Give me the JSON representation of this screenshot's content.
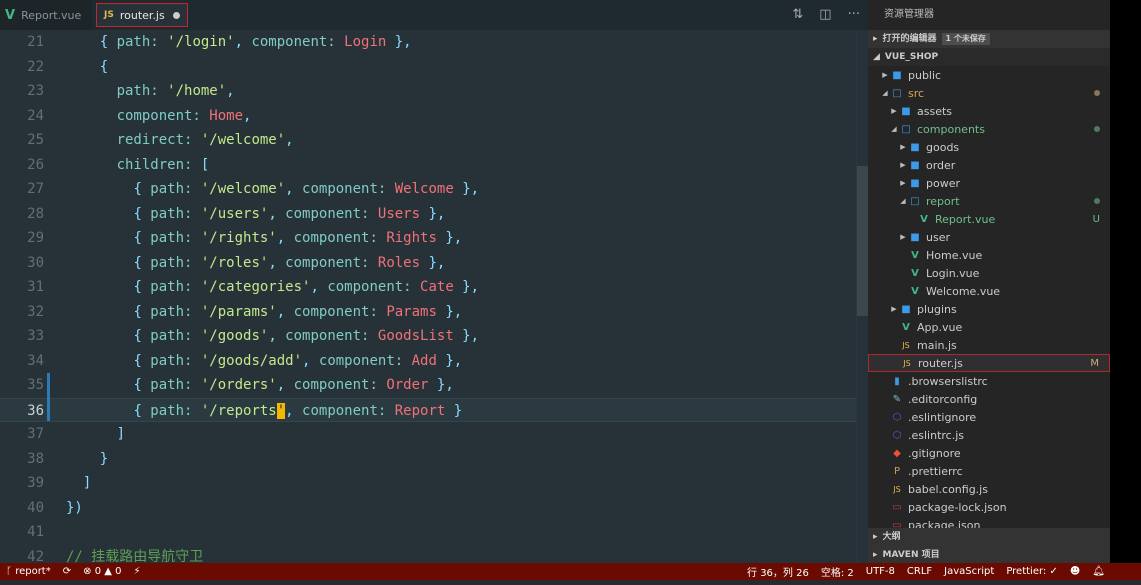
{
  "tabs": [
    {
      "label": "Report.vue",
      "icon": "vue-icon"
    },
    {
      "label": "router.js",
      "icon": "js-icon",
      "modified": true
    }
  ],
  "editor": {
    "current_line": 36,
    "cursor_char": "'",
    "lines": [
      {
        "n": 21,
        "t": [
          [
            "    ",
            ""
          ],
          [
            "{ ",
            "p"
          ],
          [
            "path: ",
            "k"
          ],
          [
            "'/login'",
            "s"
          ],
          [
            ", ",
            "p"
          ],
          [
            "component: ",
            "k"
          ],
          [
            "Login",
            "c"
          ],
          [
            " },",
            "p"
          ]
        ]
      },
      {
        "n": 22,
        "t": [
          [
            "    ",
            ""
          ],
          [
            "{",
            "p"
          ]
        ]
      },
      {
        "n": 23,
        "t": [
          [
            "      ",
            ""
          ],
          [
            "path: ",
            "k"
          ],
          [
            "'/home'",
            "s"
          ],
          [
            ",",
            "p"
          ]
        ]
      },
      {
        "n": 24,
        "t": [
          [
            "      ",
            ""
          ],
          [
            "component: ",
            "k"
          ],
          [
            "Home",
            "c"
          ],
          [
            ",",
            "p"
          ]
        ]
      },
      {
        "n": 25,
        "t": [
          [
            "      ",
            ""
          ],
          [
            "redirect: ",
            "k"
          ],
          [
            "'/welcome'",
            "s"
          ],
          [
            ",",
            "p"
          ]
        ]
      },
      {
        "n": 26,
        "t": [
          [
            "      ",
            ""
          ],
          [
            "children: ",
            "k"
          ],
          [
            "[",
            "p"
          ]
        ]
      },
      {
        "n": 27,
        "t": [
          [
            "        ",
            ""
          ],
          [
            "{ ",
            "p"
          ],
          [
            "path: ",
            "k"
          ],
          [
            "'/welcome'",
            "s"
          ],
          [
            ", ",
            "p"
          ],
          [
            "component: ",
            "k"
          ],
          [
            "Welcome",
            "c"
          ],
          [
            " },",
            "p"
          ]
        ]
      },
      {
        "n": 28,
        "t": [
          [
            "        ",
            ""
          ],
          [
            "{ ",
            "p"
          ],
          [
            "path: ",
            "k"
          ],
          [
            "'/users'",
            "s"
          ],
          [
            ", ",
            "p"
          ],
          [
            "component: ",
            "k"
          ],
          [
            "Users",
            "c"
          ],
          [
            " },",
            "p"
          ]
        ]
      },
      {
        "n": 29,
        "t": [
          [
            "        ",
            ""
          ],
          [
            "{ ",
            "p"
          ],
          [
            "path: ",
            "k"
          ],
          [
            "'/rights'",
            "s"
          ],
          [
            ", ",
            "p"
          ],
          [
            "component: ",
            "k"
          ],
          [
            "Rights",
            "c"
          ],
          [
            " },",
            "p"
          ]
        ]
      },
      {
        "n": 30,
        "t": [
          [
            "        ",
            ""
          ],
          [
            "{ ",
            "p"
          ],
          [
            "path: ",
            "k"
          ],
          [
            "'/roles'",
            "s"
          ],
          [
            ", ",
            "p"
          ],
          [
            "component: ",
            "k"
          ],
          [
            "Roles",
            "c"
          ],
          [
            " },",
            "p"
          ]
        ]
      },
      {
        "n": 31,
        "t": [
          [
            "        ",
            ""
          ],
          [
            "{ ",
            "p"
          ],
          [
            "path: ",
            "k"
          ],
          [
            "'/categories'",
            "s"
          ],
          [
            ", ",
            "p"
          ],
          [
            "component: ",
            "k"
          ],
          [
            "Cate",
            "c"
          ],
          [
            " },",
            "p"
          ]
        ]
      },
      {
        "n": 32,
        "t": [
          [
            "        ",
            ""
          ],
          [
            "{ ",
            "p"
          ],
          [
            "path: ",
            "k"
          ],
          [
            "'/params'",
            "s"
          ],
          [
            ", ",
            "p"
          ],
          [
            "component: ",
            "k"
          ],
          [
            "Params",
            "c"
          ],
          [
            " },",
            "p"
          ]
        ]
      },
      {
        "n": 33,
        "t": [
          [
            "        ",
            ""
          ],
          [
            "{ ",
            "p"
          ],
          [
            "path: ",
            "k"
          ],
          [
            "'/goods'",
            "s"
          ],
          [
            ", ",
            "p"
          ],
          [
            "component: ",
            "k"
          ],
          [
            "GoodsList",
            "c"
          ],
          [
            " },",
            "p"
          ]
        ]
      },
      {
        "n": 34,
        "t": [
          [
            "        ",
            ""
          ],
          [
            "{ ",
            "p"
          ],
          [
            "path: ",
            "k"
          ],
          [
            "'/goods/add'",
            "s"
          ],
          [
            ", ",
            "p"
          ],
          [
            "component: ",
            "k"
          ],
          [
            "Add",
            "c"
          ],
          [
            " },",
            "p"
          ]
        ]
      },
      {
        "n": 35,
        "t": [
          [
            "        ",
            ""
          ],
          [
            "{ ",
            "p"
          ],
          [
            "path: ",
            "k"
          ],
          [
            "'/orders'",
            "s"
          ],
          [
            ", ",
            "p"
          ],
          [
            "component: ",
            "k"
          ],
          [
            "Order",
            "c"
          ],
          [
            " },",
            "p"
          ]
        ]
      },
      {
        "n": 36,
        "t": [
          [
            "        ",
            ""
          ],
          [
            "{ ",
            "p"
          ],
          [
            "path: ",
            "k"
          ],
          [
            "'/reports",
            "s"
          ],
          [
            "'",
            "cursor"
          ],
          [
            ", ",
            "p"
          ],
          [
            "component: ",
            "k"
          ],
          [
            "Report",
            "c"
          ],
          [
            " }",
            "p"
          ]
        ]
      },
      {
        "n": 37,
        "t": [
          [
            "      ",
            ""
          ],
          [
            "]",
            "p"
          ]
        ]
      },
      {
        "n": 38,
        "t": [
          [
            "    ",
            ""
          ],
          [
            "}",
            "p"
          ]
        ]
      },
      {
        "n": 39,
        "t": [
          [
            "  ",
            ""
          ],
          [
            "]",
            "p"
          ]
        ]
      },
      {
        "n": 40,
        "t": [
          [
            "})",
            "p"
          ]
        ]
      },
      {
        "n": 41,
        "t": []
      },
      {
        "n": 42,
        "t": [
          [
            "// 挂载路由导航守卫",
            "cm"
          ]
        ]
      }
    ]
  },
  "explorer": {
    "title": "资源管理器",
    "open_editors": "打开的编辑器",
    "unsaved_badge": "1 个未保存",
    "project": "VUE_SHOP",
    "tree": [
      {
        "label": "public",
        "depth": 0,
        "type": "folder",
        "open": false
      },
      {
        "label": "src",
        "depth": 0,
        "type": "folder",
        "open": true,
        "color": "#d7a35a",
        "dot": "#8c7458"
      },
      {
        "label": "assets",
        "depth": 1,
        "type": "folder",
        "open": false
      },
      {
        "label": "components",
        "depth": 1,
        "type": "folder",
        "open": true,
        "color": "#6fbf8a",
        "dot": "#4f7a5e"
      },
      {
        "label": "goods",
        "depth": 2,
        "type": "folder",
        "open": false
      },
      {
        "label": "order",
        "depth": 2,
        "type": "folder",
        "open": false
      },
      {
        "label": "power",
        "depth": 2,
        "type": "folder",
        "open": false
      },
      {
        "label": "report",
        "depth": 2,
        "type": "folder",
        "open": true,
        "color": "#6fbf8a",
        "dot": "#4f7a5e"
      },
      {
        "label": "Report.vue",
        "depth": 3,
        "type": "vue",
        "color": "#6fbf8a",
        "status": "U"
      },
      {
        "label": "user",
        "depth": 2,
        "type": "folder",
        "open": false
      },
      {
        "label": "Home.vue",
        "depth": 2,
        "type": "vue",
        "file": true
      },
      {
        "label": "Login.vue",
        "depth": 2,
        "type": "vue",
        "file": true
      },
      {
        "label": "Welcome.vue",
        "depth": 2,
        "type": "vue",
        "file": true
      },
      {
        "label": "plugins",
        "depth": 1,
        "type": "folder",
        "open": false
      },
      {
        "label": "App.vue",
        "depth": 1,
        "type": "vue",
        "file": true
      },
      {
        "label": "main.js",
        "depth": 1,
        "type": "js",
        "file": true
      },
      {
        "label": "router.js",
        "depth": 1,
        "type": "js",
        "file": true,
        "selected": true,
        "status": "M"
      },
      {
        "label": ".browserslistrc",
        "depth": 0,
        "type": "doc",
        "file": true
      },
      {
        "label": ".editorconfig",
        "depth": 0,
        "type": "editorconfig",
        "file": true
      },
      {
        "label": ".eslintignore",
        "depth": 0,
        "type": "eslint",
        "file": true
      },
      {
        "label": ".eslintrc.js",
        "depth": 0,
        "type": "eslint",
        "file": true
      },
      {
        "label": ".gitignore",
        "depth": 0,
        "type": "git",
        "file": true
      },
      {
        "label": ".prettierrc",
        "depth": 0,
        "type": "prettier",
        "file": true
      },
      {
        "label": "babel.config.js",
        "depth": 0,
        "type": "js",
        "file": true
      },
      {
        "label": "package-lock.json",
        "depth": 0,
        "type": "npm",
        "file": true
      },
      {
        "label": "package.json",
        "depth": 0,
        "type": "npm",
        "file": true
      }
    ],
    "outline": "大纲",
    "maven": "MAVEN 项目"
  },
  "status": {
    "branch": "report*",
    "errors": "0",
    "warnings": "0",
    "position": "行 36，列 26",
    "spaces": "空格: 2",
    "encoding": "UTF-8",
    "eol": "CRLF",
    "language": "JavaScript",
    "prettier": "Prettier: ✓"
  },
  "colors": {
    "statusbar": "#6b0a00",
    "editor_bg": "#263238",
    "sidebar_bg": "#252526"
  }
}
